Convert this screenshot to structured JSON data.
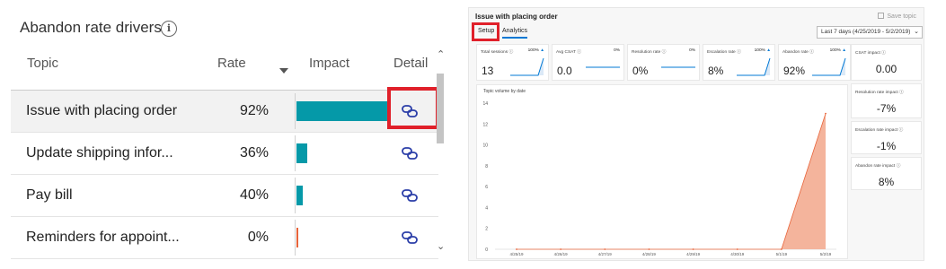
{
  "left": {
    "title": "Abandon rate drivers",
    "info_glyph": "i",
    "columns": {
      "topic": "Topic",
      "rate": "Rate",
      "impact": "Impact",
      "detail": "Detail"
    },
    "rows": [
      {
        "topic": "Issue with placing order",
        "rate": "92%",
        "impact": 1.0
      },
      {
        "topic": "Update shipping infor...",
        "rate": "36%",
        "impact": 0.118
      },
      {
        "topic": "Pay bill",
        "rate": "40%",
        "impact": 0.07
      },
      {
        "topic": "Reminders for appoint...",
        "rate": "0%",
        "impact": 0.02
      }
    ],
    "colors": {
      "bar": "#0599a8",
      "zero_bar": "#e8643a",
      "link_icon": "#2b3ea8",
      "highlight": "#e0202a"
    },
    "icons": {
      "link": "link-icon",
      "info": "info-icon",
      "sort": "sort-down-icon"
    }
  },
  "right": {
    "title": "Issue with placing order",
    "save_label": "Save topic",
    "tabs": [
      "Setup",
      "Analytics"
    ],
    "date_range": "Last 7 days (4/25/2019 - 5/2/2019)",
    "kpis": [
      {
        "label": "Total sessions",
        "pct": "100%",
        "value": "13",
        "spark": true
      },
      {
        "label": "Avg CSAT",
        "pct": "0%",
        "value": "0.0",
        "spark": false
      },
      {
        "label": "Resolution rate",
        "pct": "0%",
        "value": "0%",
        "spark": false
      },
      {
        "label": "Escalation rate",
        "pct": "100%",
        "value": "8%",
        "spark": true
      },
      {
        "label": "Abandon rate",
        "pct": "100%",
        "value": "92%",
        "spark": true
      }
    ],
    "side_cards": [
      {
        "label": "CSAT impact",
        "value": "0.00"
      },
      {
        "label": "Resolution rate impact",
        "value": "-7%"
      },
      {
        "label": "Escalation rate impact",
        "value": "-1%"
      },
      {
        "label": "Abandon rate impact",
        "value": "8%"
      }
    ],
    "colors": {
      "accent": "#0078d4",
      "area_fill": "#f4b49c",
      "area_line": "#e8643a"
    }
  },
  "chart_data": {
    "type": "area",
    "title": "Topic volume by date",
    "x": [
      "4/25/19",
      "4/26/19",
      "4/27/19",
      "4/28/19",
      "4/29/19",
      "4/30/19",
      "5/1/19",
      "5/2/19"
    ],
    "series": [
      {
        "values": [
          0,
          0,
          0,
          0,
          0,
          0,
          0,
          13
        ]
      }
    ],
    "y_ticks": [
      "0",
      "2",
      "4",
      "6",
      "8",
      "10",
      "12",
      "14"
    ],
    "ylim": [
      0,
      14
    ],
    "grid": false
  }
}
